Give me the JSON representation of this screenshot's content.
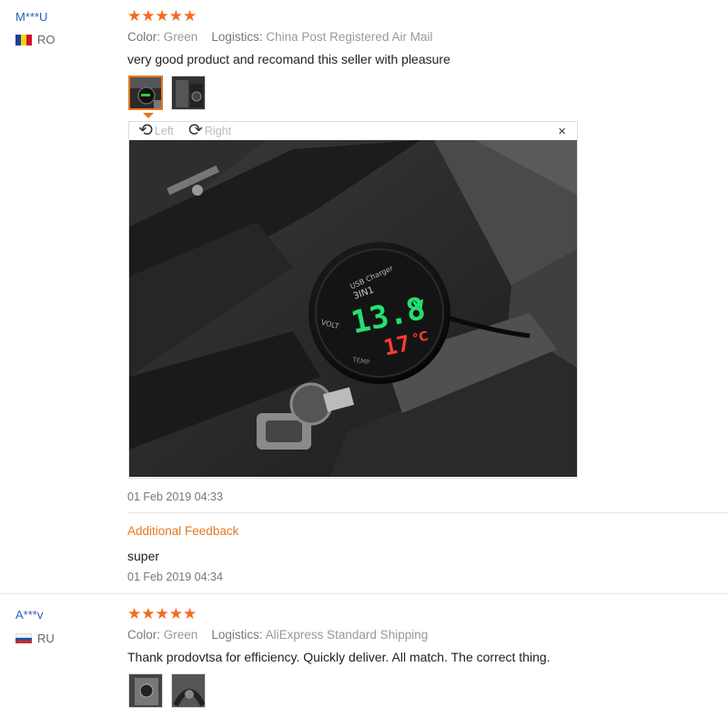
{
  "reviews": [
    {
      "user": "M***U",
      "country": "RO",
      "stars": "★★★★★",
      "color_label": "Color:",
      "color_value": "Green",
      "logistics_label": "Logistics:",
      "logistics_value": "China Post Registered Air Mail",
      "text": "very good product and recomand this seller with pleasure",
      "viewer": {
        "rotate_left": "Left",
        "rotate_right": "Right",
        "close": "×",
        "display_digits": "13.8",
        "display_unit_v": "V",
        "display_temp": "17",
        "display_unit_c": "°C",
        "device_label": "3IN1",
        "device_top": "USB Charger",
        "device_left": "VOLT",
        "device_bottom": "TEMP"
      },
      "date": "01 Feb 2019 04:33",
      "additional_label": "Additional Feedback",
      "additional_text": "super",
      "additional_date": "01 Feb 2019 04:34"
    },
    {
      "user": "A***v",
      "country": "RU",
      "stars": "★★★★★",
      "color_label": "Color:",
      "color_value": "Green",
      "logistics_label": "Logistics:",
      "logistics_value": "AliExpress Standard Shipping",
      "text": "Thank prodovtsa for efficiency. Quickly deliver. All match. The correct thing."
    }
  ],
  "colors": {
    "accent": "#e67820",
    "link": "#2a62bd",
    "star": "#f26c1e"
  }
}
